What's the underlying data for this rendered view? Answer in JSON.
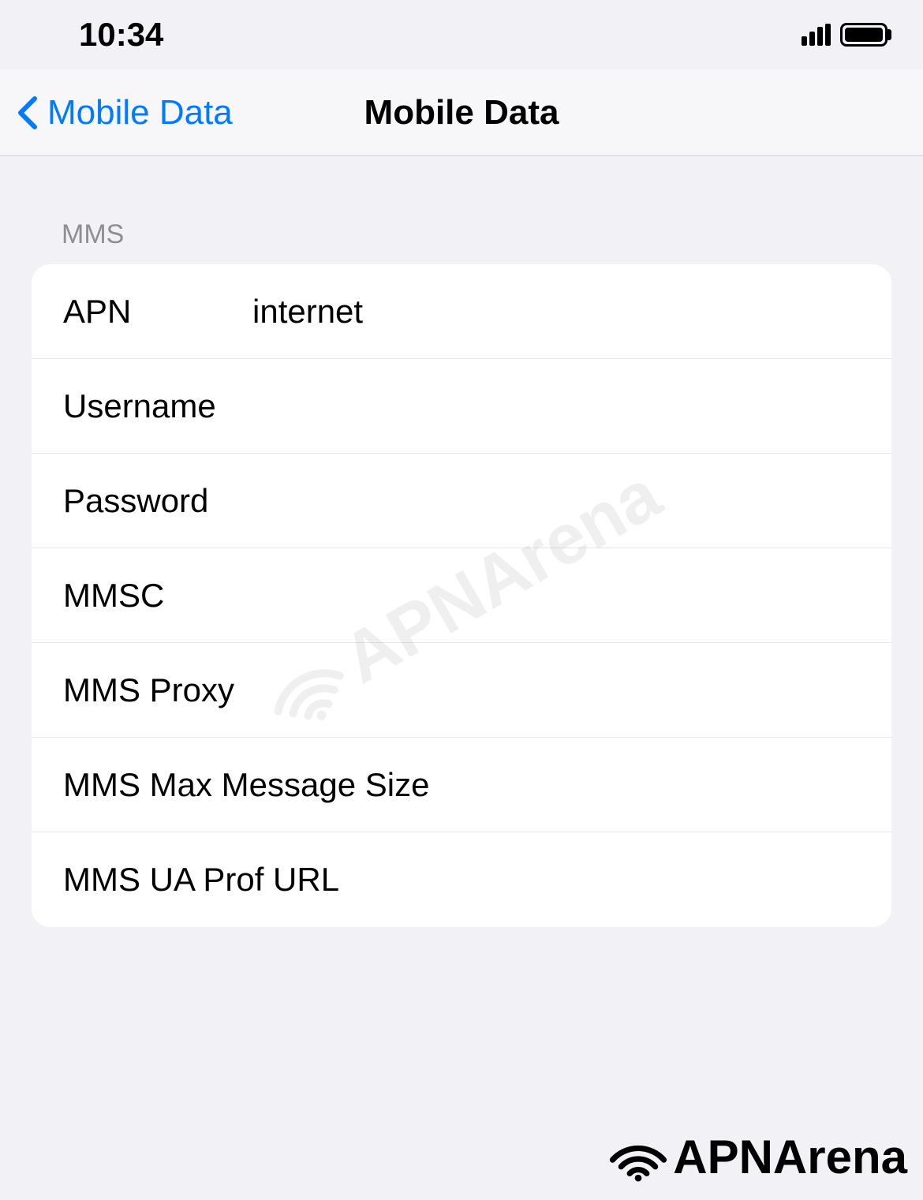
{
  "status_bar": {
    "time": "10:34"
  },
  "nav": {
    "back_label": "Mobile Data",
    "title": "Mobile Data"
  },
  "section": {
    "header": "MMS",
    "rows": {
      "apn": {
        "label": "APN",
        "value": "internet"
      },
      "username": {
        "label": "Username",
        "value": ""
      },
      "password": {
        "label": "Password",
        "value": ""
      },
      "mmsc": {
        "label": "MMSC",
        "value": ""
      },
      "mms_proxy": {
        "label": "MMS Proxy",
        "value": ""
      },
      "mms_max": {
        "label": "MMS Max Message Size",
        "value": ""
      },
      "mms_ua": {
        "label": "MMS UA Prof URL",
        "value": ""
      }
    }
  },
  "watermark": {
    "center": "APNArena",
    "bottom": "APNArena"
  }
}
